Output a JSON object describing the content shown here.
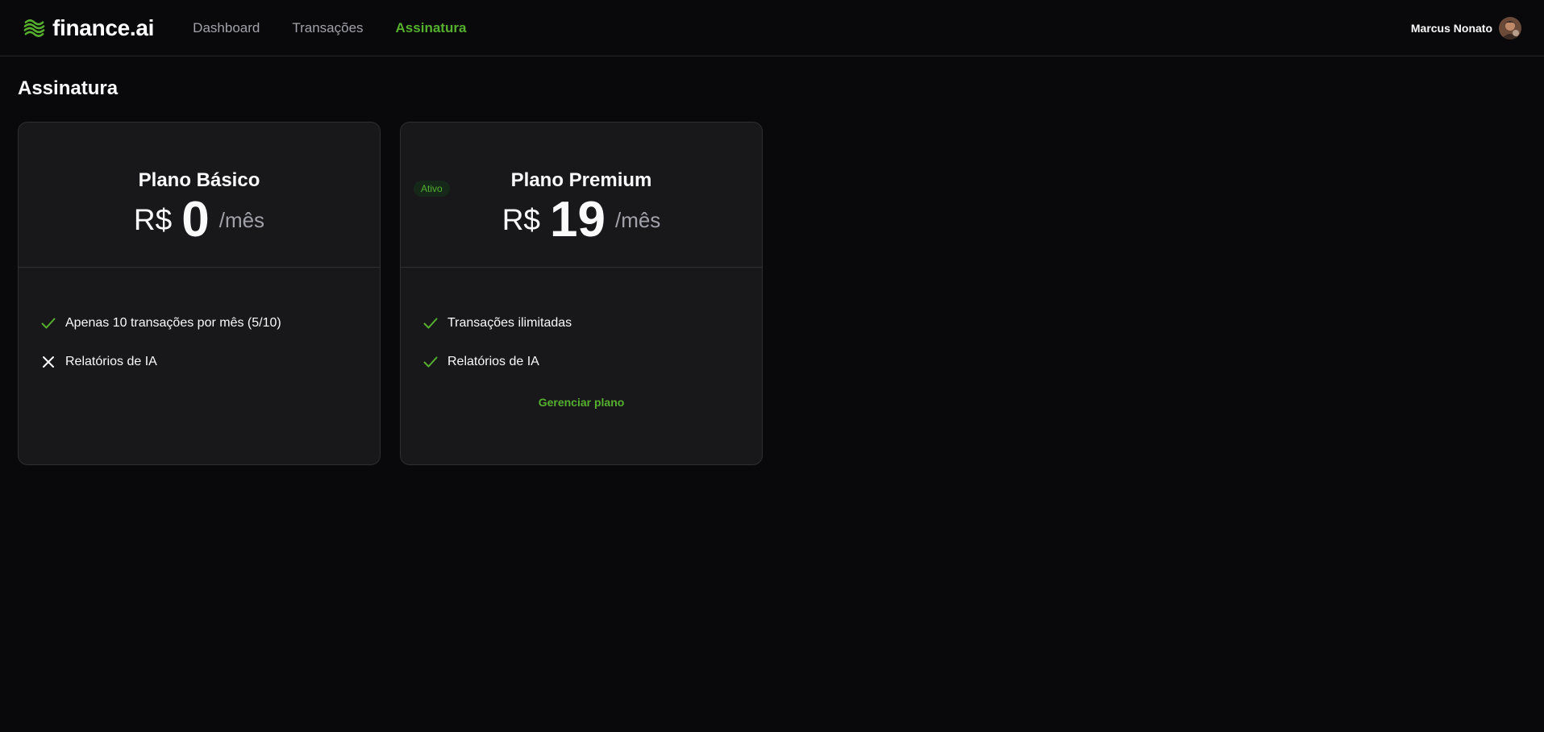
{
  "brand": {
    "name": "finance.ai",
    "accent_color": "#55b02e",
    "logo_icon": "waves-logo-icon"
  },
  "nav": {
    "items": [
      {
        "label": "Dashboard",
        "active": false
      },
      {
        "label": "Transações",
        "active": false
      },
      {
        "label": "Assinatura",
        "active": true
      }
    ]
  },
  "user": {
    "name": "Marcus Nonato",
    "avatar_icon": "user-avatar"
  },
  "page": {
    "title": "Assinatura"
  },
  "plans": [
    {
      "name": "Plano Básico",
      "currency": "R$",
      "price": "0",
      "period": "/mês",
      "features": [
        {
          "label": "Apenas 10 transações por mês (5/10)",
          "icon": "check-icon",
          "included": true
        },
        {
          "label": "Relatórios de IA",
          "icon": "x-icon",
          "included": false
        }
      ]
    },
    {
      "name": "Plano Premium",
      "badge": "Ativo",
      "currency": "R$",
      "price": "19",
      "period": "/mês",
      "features": [
        {
          "label": "Transações ilimitadas",
          "icon": "check-icon",
          "included": true
        },
        {
          "label": "Relatórios de IA",
          "icon": "check-icon",
          "included": true
        }
      ],
      "action_label": "Gerenciar plano"
    }
  ]
}
